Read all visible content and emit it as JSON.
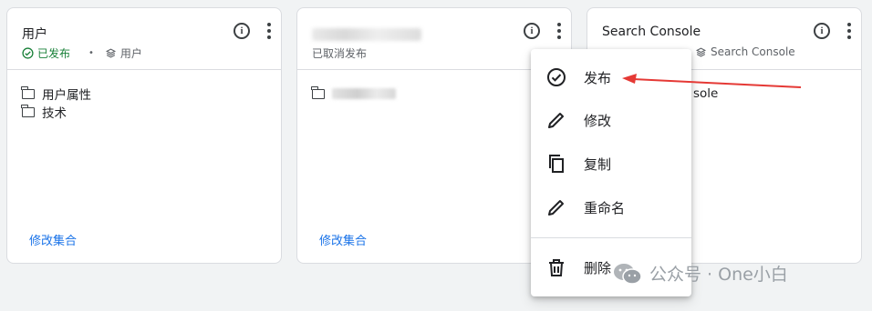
{
  "cards": [
    {
      "title": "用户",
      "status": "已发布",
      "collection": "用户",
      "items": [
        "用户属性",
        "技术"
      ],
      "edit_link": "修改集合"
    },
    {
      "status": "已取消发布",
      "edit_link": "修改集合"
    },
    {
      "title": "Search Console",
      "collection": "Search Console",
      "item_partial": "sole"
    }
  ],
  "menu": {
    "items": [
      {
        "label": "发布",
        "icon": "check-circle-icon"
      },
      {
        "label": "修改",
        "icon": "pencil-icon"
      },
      {
        "label": "复制",
        "icon": "copy-icon"
      },
      {
        "label": "重命名",
        "icon": "pencil-icon"
      },
      {
        "label": "删除",
        "icon": "trash-icon"
      }
    ]
  },
  "watermark": "公众号 · One小白",
  "colors": {
    "published": "#188038",
    "link": "#1a73e8",
    "arrow": "#e53935"
  }
}
